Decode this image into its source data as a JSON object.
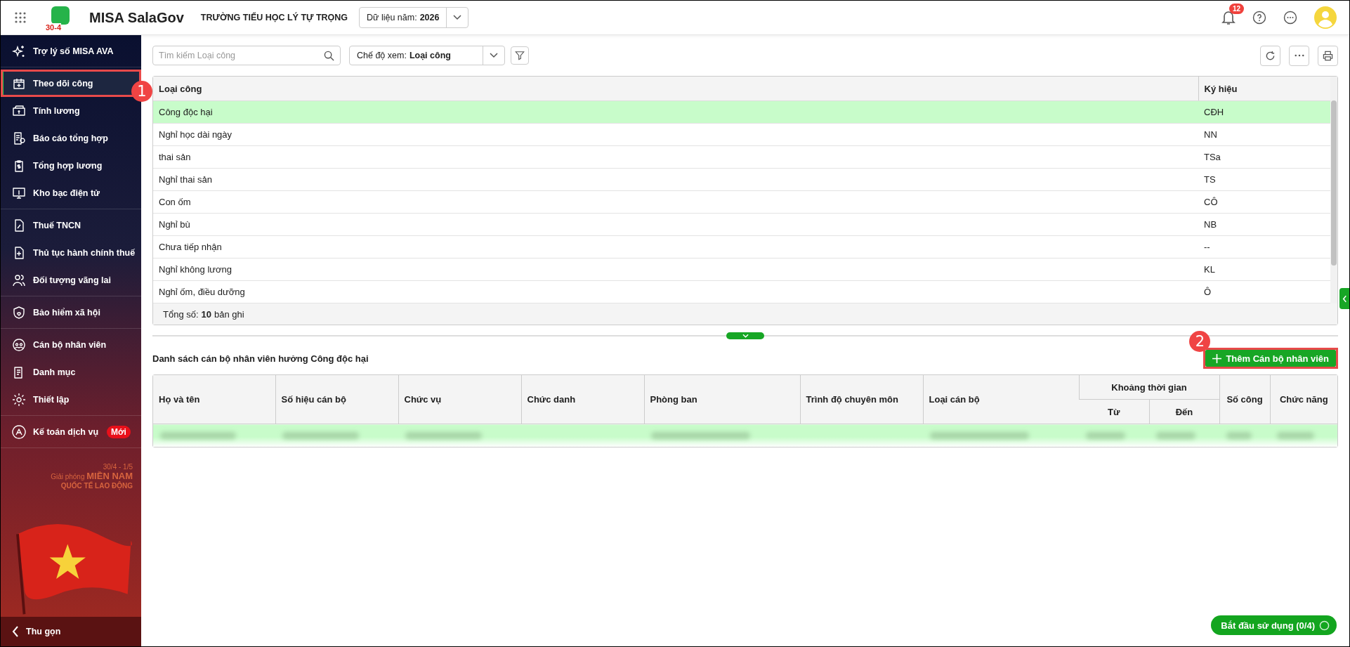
{
  "app": {
    "logo_text": "30-4",
    "title": "MISA SalaGov",
    "organization": "TRƯỜNG TIỂU HỌC LÝ TỰ TRỌNG",
    "year_label": "Dữ liệu năm:",
    "year_value": "2026",
    "notification_count": "12"
  },
  "sidebar": {
    "assistant": "Trợ lý số MISA AVA",
    "groups": [
      [
        {
          "label": "Theo dõi công",
          "selected": true,
          "highlighted": true,
          "callout": "1"
        },
        {
          "label": "Tính lương",
          "selected": false,
          "highlighted": false
        },
        {
          "label": "Báo cáo tổng hợp",
          "selected": false,
          "highlighted": false
        },
        {
          "label": "Tổng hợp lương",
          "selected": false,
          "highlighted": false
        },
        {
          "label": "Kho bạc điện tử",
          "selected": false,
          "highlighted": false
        }
      ],
      [
        {
          "label": "Thuế TNCN",
          "selected": false,
          "highlighted": false
        },
        {
          "label": "Thủ tục hành chính thuế",
          "selected": false,
          "highlighted": false
        },
        {
          "label": "Đối tượng vãng lai",
          "selected": false,
          "highlighted": false
        }
      ],
      [
        {
          "label": "Bảo hiểm xã hội",
          "selected": false,
          "highlighted": false
        }
      ],
      [
        {
          "label": "Cán bộ nhân viên",
          "selected": false,
          "highlighted": false
        },
        {
          "label": "Danh mục",
          "selected": false,
          "highlighted": false
        },
        {
          "label": "Thiết lập",
          "selected": false,
          "highlighted": false
        }
      ],
      [
        {
          "label": "Kế toán dịch vụ",
          "selected": false,
          "highlighted": false,
          "badge": "Mới"
        }
      ]
    ],
    "banner": {
      "dates": "30/4 - 1/5",
      "line1": "Giải phóng",
      "line1_emphasis": "MIỀN NAM",
      "line2": "QUỐC TẾ LAO ĐỘNG"
    },
    "collapse": "Thu gọn"
  },
  "toolbar": {
    "search_placeholder": "Tìm kiếm Loại công",
    "view_mode_label": "Chế độ xem:",
    "view_mode_value": "Loại công"
  },
  "work_types": {
    "columns": [
      "Loại công",
      "Ký hiệu"
    ],
    "rows": [
      {
        "name": "Công độc hại",
        "code": "CĐH",
        "selected": true
      },
      {
        "name": "Nghỉ học dài ngày",
        "code": "NN",
        "selected": false
      },
      {
        "name": "thai sản",
        "code": "TSa",
        "selected": false
      },
      {
        "name": "Nghỉ thai sản",
        "code": "TS",
        "selected": false
      },
      {
        "name": "Con ốm",
        "code": "CÔ",
        "selected": false
      },
      {
        "name": "Nghỉ bù",
        "code": "NB",
        "selected": false
      },
      {
        "name": "Chưa tiếp nhận",
        "code": "--",
        "selected": false
      },
      {
        "name": "Nghỉ không lương",
        "code": "KL",
        "selected": false
      },
      {
        "name": "Nghỉ ốm, điều dưỡng",
        "code": "Ô",
        "selected": false
      }
    ],
    "total_label": "Tổng số:",
    "total_count": "10",
    "total_unit": "bản ghi"
  },
  "staff": {
    "title": "Danh sách cán bộ nhân viên hưởng Công độc hại",
    "add_button": {
      "label": "Thêm Cán bộ nhân viên",
      "highlighted": true,
      "callout": "2"
    },
    "columns": [
      "Họ và tên",
      "Số hiệu cán bộ",
      "Chức vụ",
      "Chức danh",
      "Phòng ban",
      "Trình độ chuyên môn",
      "Loại cán bộ"
    ],
    "period_group": "Khoảng thời gian",
    "period_columns": [
      "Từ",
      "Đến"
    ],
    "trailing_columns": [
      "Số công",
      "Chức năng"
    ],
    "rows": [
      {
        "selected": true
      }
    ]
  },
  "start_button": "Bắt đầu sử dụng (0/4)"
}
